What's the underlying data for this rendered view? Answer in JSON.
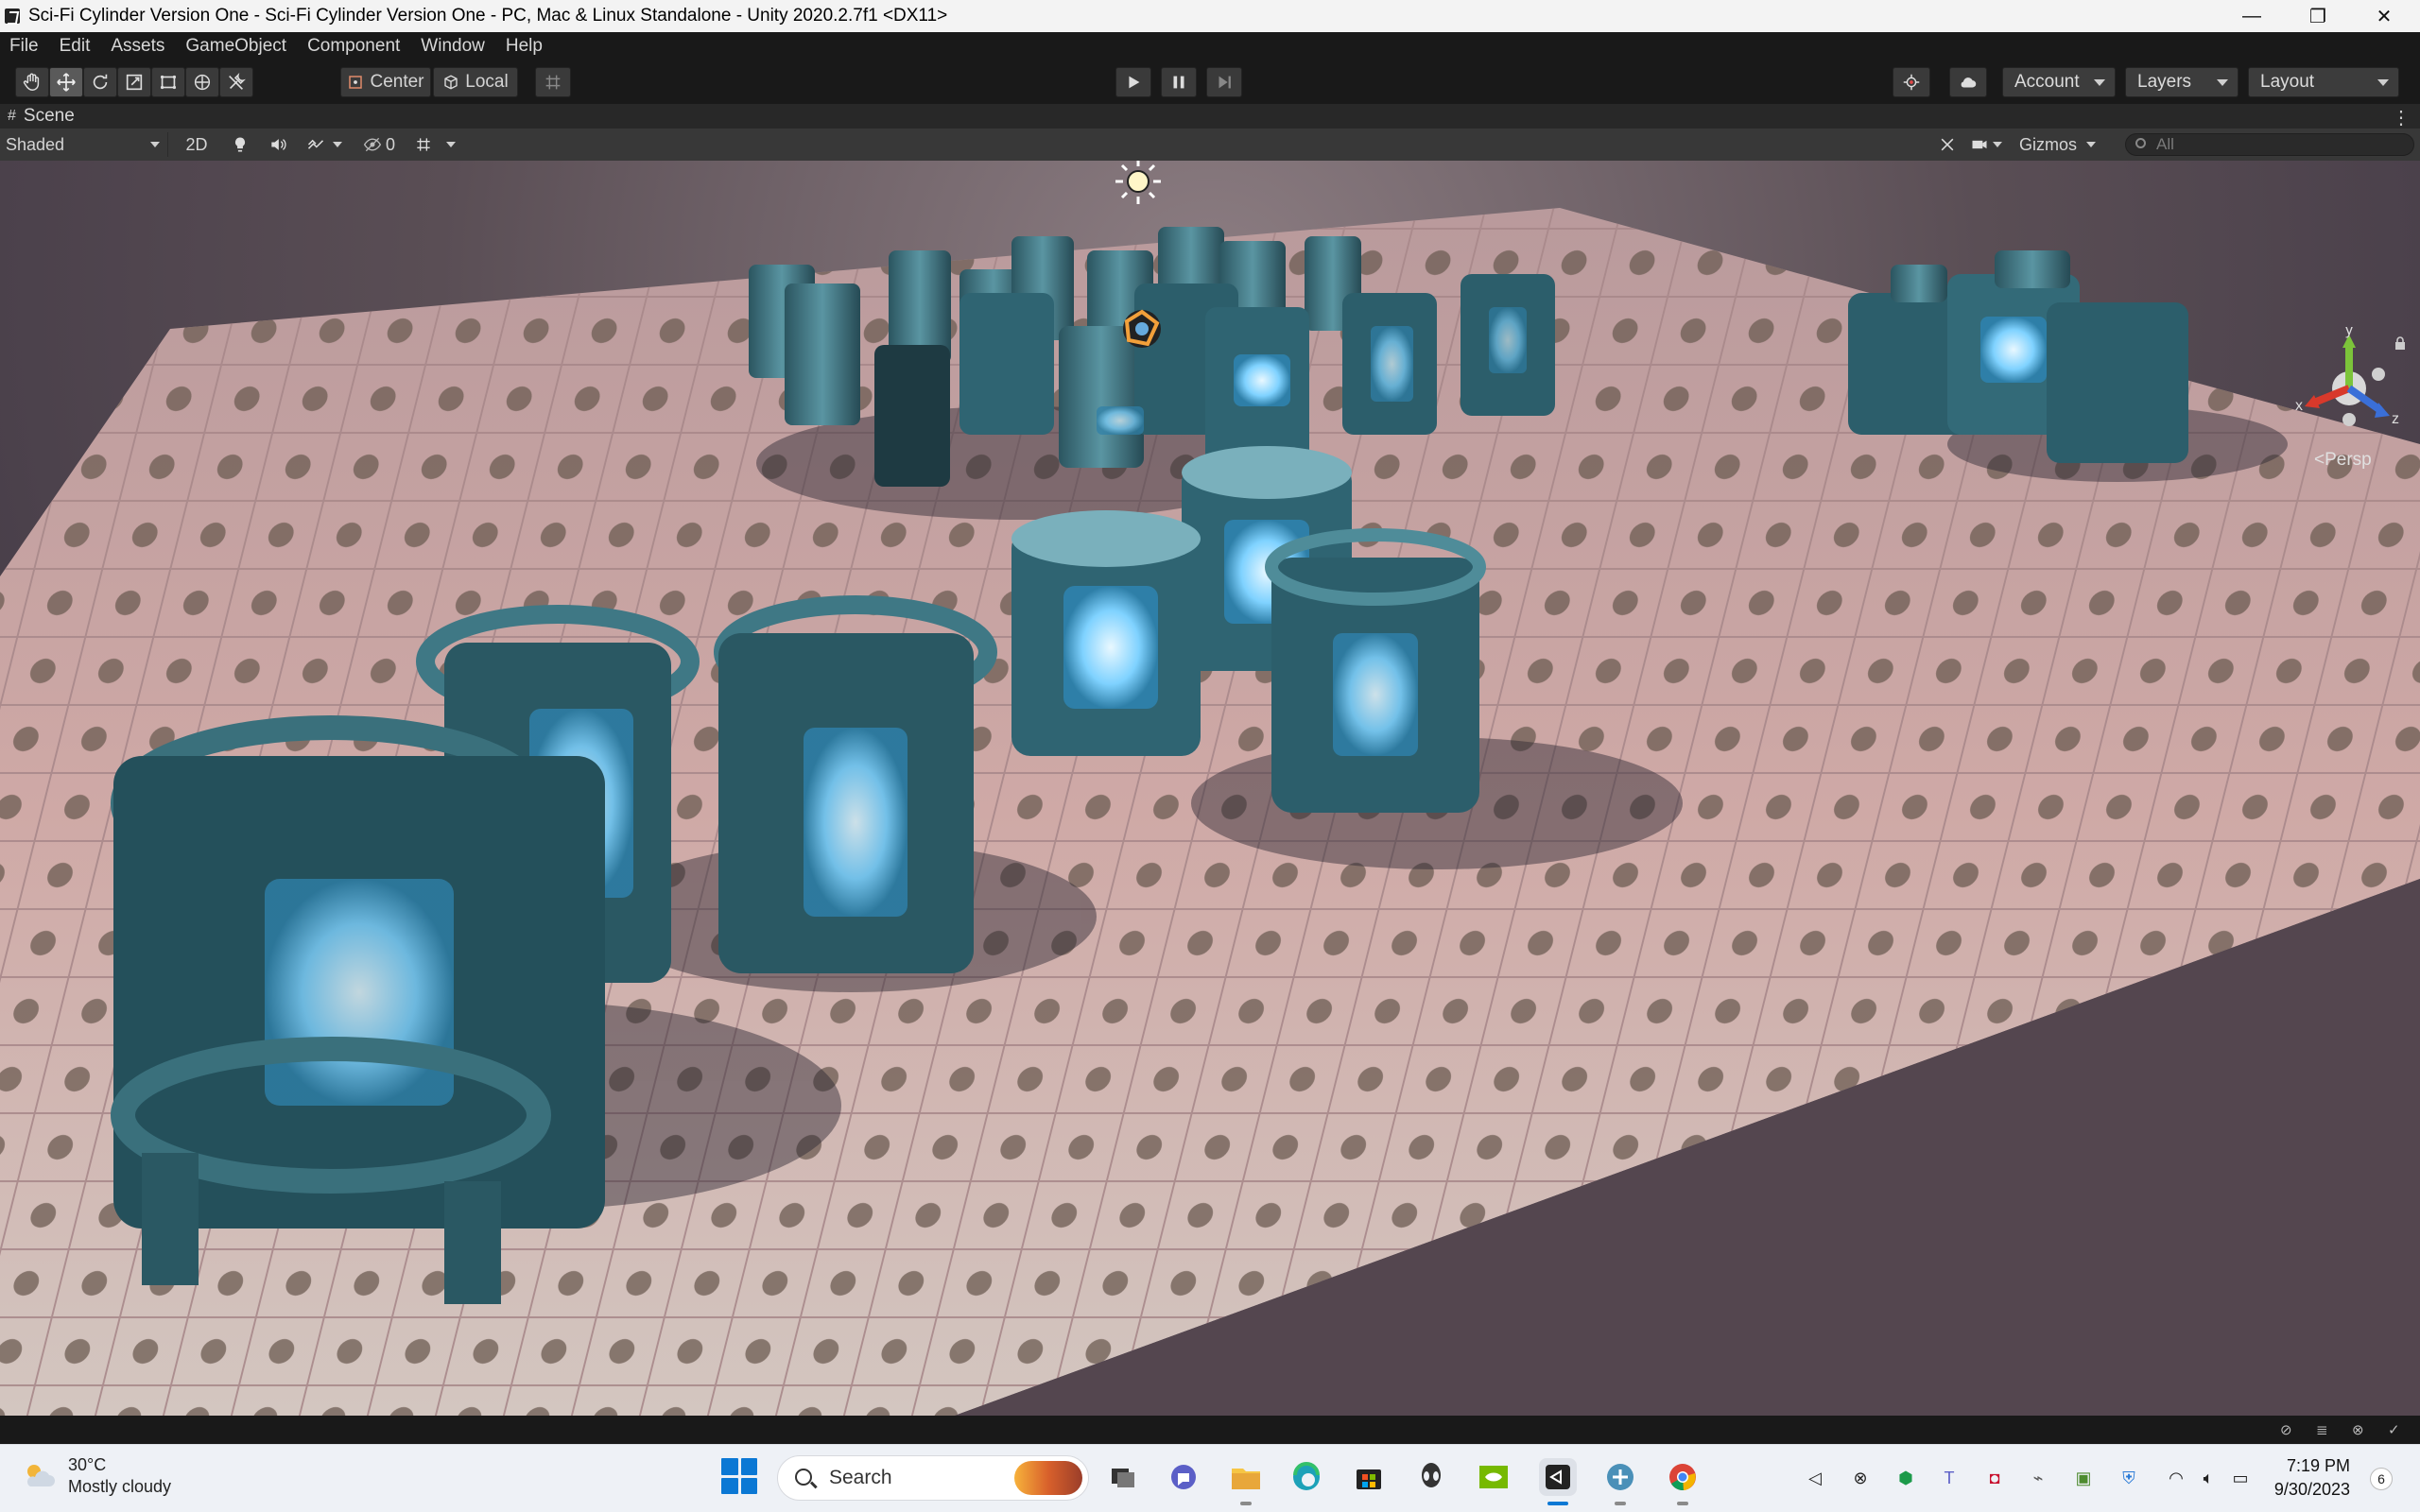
{
  "window": {
    "title": "Sci-Fi Cylinder Version One - Sci-Fi Cylinder Version One - PC, Mac & Linux Standalone - Unity 2020.2.7f1 <DX11>",
    "minimize": "—",
    "restore": "❐",
    "close": "✕"
  },
  "menu": [
    "File",
    "Edit",
    "Assets",
    "GameObject",
    "Component",
    "Window",
    "Help"
  ],
  "toolbar": {
    "pivot_label": "Center",
    "space_label": "Local",
    "account_label": "Account",
    "layers_label": "Layers",
    "layout_label": "Layout"
  },
  "scene_tab": {
    "label": "Scene"
  },
  "scene_toolbar": {
    "draw_mode": "Shaded",
    "mode_2d": "2D",
    "hidden_count": "0",
    "gizmos_label": "Gizmos",
    "search_placeholder": "All"
  },
  "gizmo": {
    "y": "y",
    "x": "x",
    "z": "z",
    "projection": "Persp"
  },
  "taskbar": {
    "temperature": "30°C",
    "weather": "Mostly cloudy",
    "search_label": "Search",
    "time": "7:19 PM",
    "date": "9/30/2023",
    "notification_count": "6"
  },
  "colors": {
    "editor_bg": "#191919",
    "scene_floor": "#c9a3a2",
    "glow": "#7fd2ff",
    "metal": "#3d6f7a",
    "start_blue": "#0b78d4"
  }
}
